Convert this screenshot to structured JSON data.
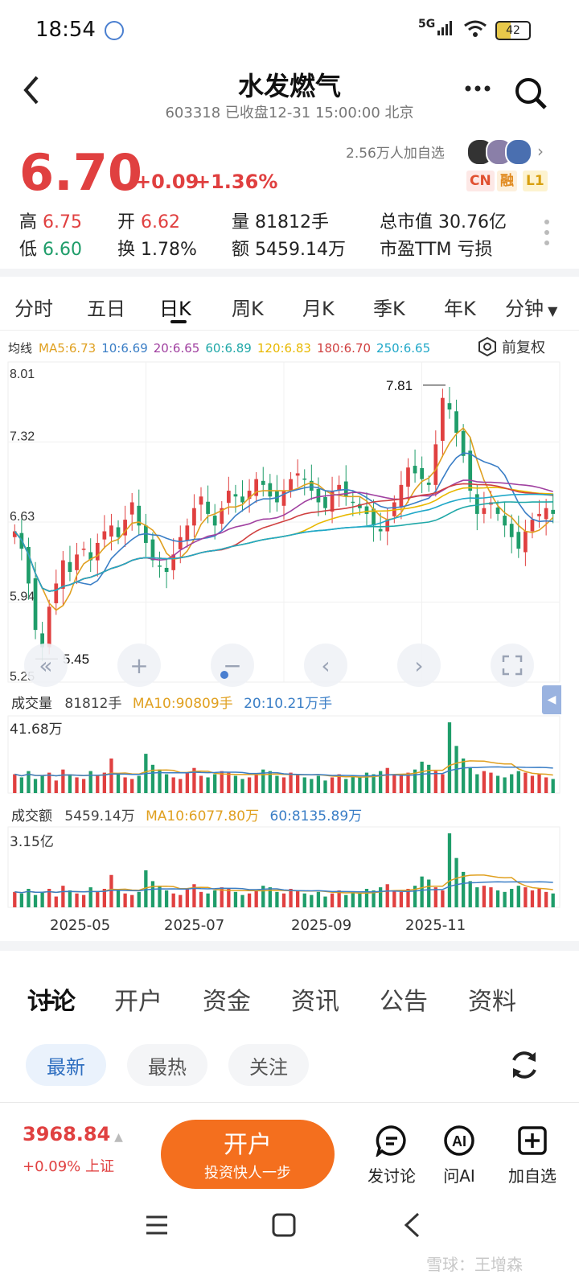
{
  "status_bar": {
    "time": "18:54",
    "network": "5G",
    "battery": "42"
  },
  "header": {
    "title": "水发燃气",
    "subtitle": "603318 已收盘12-31 15:00:00 北京"
  },
  "quote": {
    "price": "6.70",
    "change": "+0.09",
    "change_pct": "+1.36%",
    "followers": "2.56万人加自选",
    "badges": [
      "CN",
      "融",
      "L1"
    ],
    "stats": [
      {
        "label": "高",
        "value": "6.75"
      },
      {
        "label": "开",
        "value": "6.62"
      },
      {
        "label": "量",
        "value": "81812手"
      },
      {
        "label": "总市值",
        "value": "30.76亿"
      },
      {
        "label": "低",
        "value": "6.60"
      },
      {
        "label": "换",
        "value": "1.78%"
      },
      {
        "label": "额",
        "value": "5459.14万"
      },
      {
        "label": "市盈TTM",
        "value": "亏损"
      }
    ]
  },
  "period_tabs": [
    "分时",
    "五日",
    "日K",
    "周K",
    "月K",
    "季K",
    "年K",
    "分钟"
  ],
  "active_period": "日K",
  "ma_legend": {
    "label": "均线",
    "items": [
      {
        "text": "MA5:6.73",
        "color": "#e0a020"
      },
      {
        "text": "10:6.69",
        "color": "#3a7ec6"
      },
      {
        "text": "20:6.65",
        "color": "#a040a0"
      },
      {
        "text": "60:6.89",
        "color": "#20a8a8"
      },
      {
        "text": "120:6.83",
        "color": "#e8b800"
      },
      {
        "text": "180:6.70",
        "color": "#d04040"
      },
      {
        "text": "250:6.65",
        "color": "#20a8c8"
      }
    ],
    "adjust": "前复权"
  },
  "chart_data": [
    {
      "type": "candlestick",
      "y_ticks": [
        "8.01",
        "7.32",
        "6.63",
        "5.94",
        "5.25"
      ],
      "ylim": [
        5.25,
        8.01
      ],
      "annotations": [
        {
          "text": "7.81",
          "value": 7.81
        },
        {
          "text": "5.45",
          "value": 5.45
        }
      ],
      "close_series": [
        6.55,
        6.4,
        6.1,
        5.7,
        5.55,
        5.9,
        6.1,
        6.3,
        6.2,
        6.35,
        6.4,
        6.3,
        6.45,
        6.55,
        6.6,
        6.5,
        6.65,
        6.8,
        6.6,
        6.45,
        6.3,
        6.25,
        6.2,
        6.35,
        6.5,
        6.6,
        6.75,
        6.85,
        6.7,
        6.6,
        6.75,
        6.9,
        6.85,
        6.8,
        6.9,
        7.0,
        6.95,
        6.85,
        6.8,
        6.9,
        7.0,
        7.05,
        7.0,
        6.9,
        6.8,
        6.75,
        6.9,
        6.95,
        6.85,
        6.8,
        6.75,
        6.7,
        6.6,
        6.55,
        6.65,
        6.8,
        6.95,
        7.1,
        7.05,
        7.0,
        6.95,
        7.3,
        7.7,
        7.6,
        7.4,
        7.2,
        6.9,
        6.7,
        6.75,
        6.8,
        6.7,
        6.6,
        6.5,
        6.4,
        6.55,
        6.65,
        6.7,
        6.75,
        6.7
      ],
      "x_labels": [
        "2025-05",
        "2025-07",
        "2025-09",
        "2025-11"
      ]
    },
    {
      "type": "bar",
      "name": "成交量",
      "legend": {
        "label": "成交量",
        "v": "81812手",
        "ma10": "MA10:90809手",
        "ma20": "20:10.21万手"
      },
      "y_max_label": "41.68万",
      "values": [
        12,
        10,
        14,
        9,
        11,
        13,
        8,
        15,
        12,
        10,
        9,
        14,
        11,
        13,
        22,
        12,
        10,
        9,
        11,
        25,
        18,
        15,
        12,
        10,
        9,
        13,
        16,
        11,
        10,
        12,
        14,
        13,
        11,
        9,
        10,
        12,
        15,
        14,
        11,
        10,
        13,
        12,
        10,
        9,
        11,
        8,
        10,
        12,
        9,
        11,
        10,
        13,
        12,
        14,
        16,
        12,
        11,
        13,
        15,
        20,
        18,
        14,
        12,
        45,
        30,
        22,
        16,
        12,
        14,
        13,
        11,
        10,
        12,
        14,
        13,
        11,
        12,
        10,
        9
      ]
    },
    {
      "type": "bar",
      "name": "成交额",
      "legend": {
        "label": "成交额",
        "v": "5459.14万",
        "ma10": "MA10:6077.80万",
        "ma60": "60:8135.89万"
      },
      "y_max_label": "3.15亿",
      "values": [
        10,
        9,
        12,
        8,
        10,
        12,
        7,
        14,
        11,
        9,
        8,
        13,
        10,
        12,
        21,
        11,
        9,
        8,
        10,
        24,
        17,
        14,
        11,
        9,
        8,
        12,
        15,
        10,
        9,
        11,
        13,
        12,
        10,
        8,
        9,
        11,
        14,
        13,
        10,
        9,
        12,
        11,
        9,
        8,
        10,
        7,
        9,
        11,
        8,
        10,
        9,
        12,
        11,
        13,
        15,
        11,
        10,
        12,
        14,
        20,
        18,
        13,
        11,
        48,
        32,
        23,
        17,
        13,
        14,
        13,
        11,
        10,
        12,
        14,
        13,
        11,
        12,
        10,
        9
      ]
    }
  ],
  "discussion_tabs": [
    "讨论",
    "开户",
    "资金",
    "资讯",
    "公告",
    "资料"
  ],
  "sub_tabs": [
    "最新",
    "最热",
    "关注"
  ],
  "bottom_bar": {
    "index_value": "3968.84",
    "index_change": "+0.09% 上证",
    "open_account_label": "开户",
    "open_account_sub": "投资快人一步",
    "actions": [
      "发讨论",
      "问AI",
      "加自选"
    ]
  },
  "watermark": "雪球：王增森"
}
